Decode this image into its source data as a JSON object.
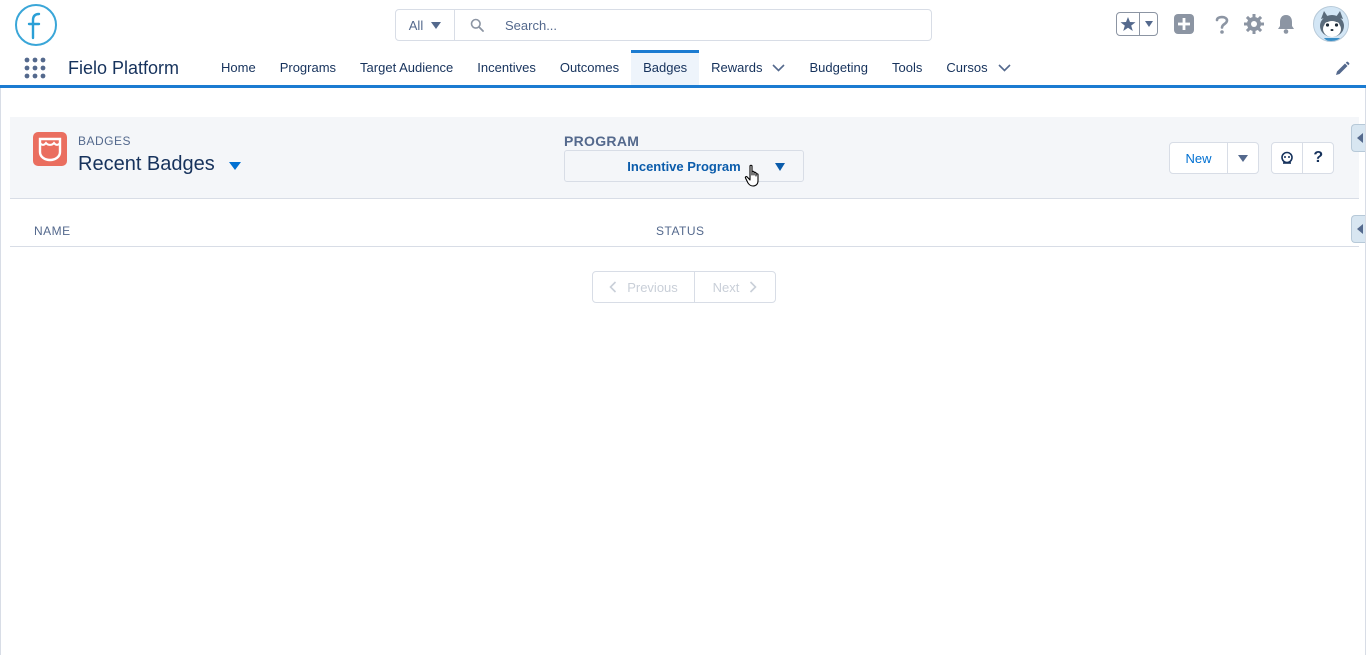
{
  "header": {
    "logo_icon": "fielo-f-logo",
    "search": {
      "scope_label": "All",
      "placeholder": "Search..."
    },
    "icons": [
      "star-favorites-icon",
      "add-icon",
      "help-icon",
      "setup-gear-icon",
      "notifications-bell-icon",
      "user-avatar"
    ]
  },
  "nav": {
    "app_name": "Fielo Platform",
    "items": [
      {
        "label": "Home"
      },
      {
        "label": "Programs"
      },
      {
        "label": "Target Audience"
      },
      {
        "label": "Incentives"
      },
      {
        "label": "Outcomes"
      },
      {
        "label": "Badges",
        "active": true
      },
      {
        "label": "Rewards",
        "dropdown": true
      },
      {
        "label": "Budgeting"
      },
      {
        "label": "Tools"
      },
      {
        "label": "Cursos",
        "dropdown": true
      }
    ]
  },
  "list_view": {
    "object_label": "BADGES",
    "title": "Recent Badges",
    "program": {
      "label": "PROGRAM",
      "selected": "Incentive Program"
    },
    "new_button": "New",
    "help_label": "?",
    "columns": [
      "NAME",
      "STATUS"
    ],
    "pager": {
      "previous": "Previous",
      "next": "Next"
    }
  },
  "colors": {
    "brand_blue": "#1b7bd1",
    "badge_icon": "#ea6e5f",
    "link_blue": "#0070d2"
  }
}
